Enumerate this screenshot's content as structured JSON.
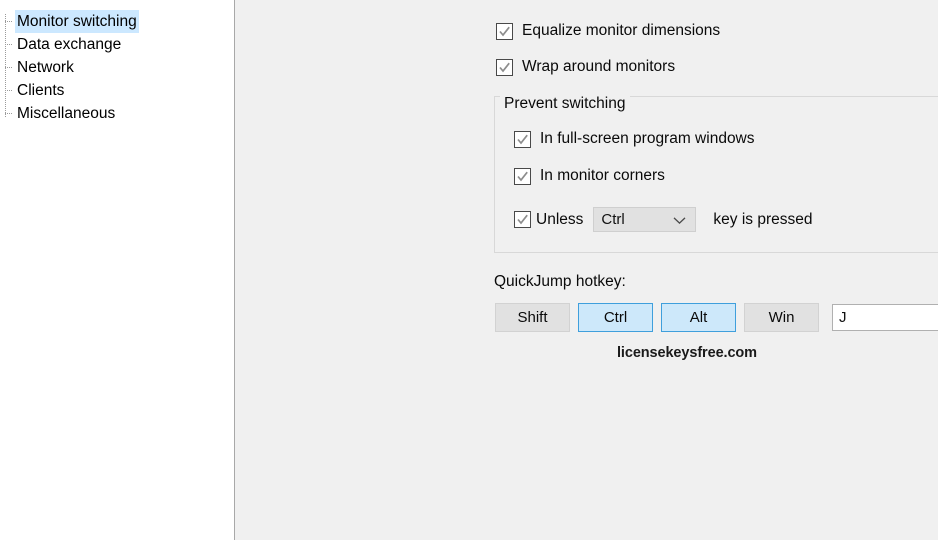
{
  "sidebar": {
    "items": [
      {
        "label": "Monitor switching",
        "selected": true
      },
      {
        "label": "Data exchange",
        "selected": false
      },
      {
        "label": "Network",
        "selected": false
      },
      {
        "label": "Clients",
        "selected": false
      },
      {
        "label": "Miscellaneous",
        "selected": false
      }
    ]
  },
  "main": {
    "checkboxes": [
      {
        "label": "Equalize monitor dimensions",
        "checked": true
      },
      {
        "label": "Wrap around monitors",
        "checked": true
      }
    ],
    "group": {
      "title": "Prevent switching",
      "checkboxes": [
        {
          "label": "In full-screen program windows",
          "checked": true
        },
        {
          "label": "In monitor corners",
          "checked": true
        }
      ],
      "unless_row": {
        "checked": true,
        "prefix_label": "Unless",
        "key_value": "Ctrl",
        "suffix_label": "key is pressed"
      }
    },
    "quickjump": {
      "section_label": "QuickJump hotkey:",
      "modifiers": [
        {
          "label": "Shift",
          "active": false
        },
        {
          "label": "Ctrl",
          "active": true
        },
        {
          "label": "Alt",
          "active": true
        },
        {
          "label": "Win",
          "active": false
        }
      ],
      "key_value": "J"
    },
    "watermark": "licensekeysfree.com"
  },
  "colors": {
    "selection_blue": "#cce8ff",
    "button_active_fill": "#cde8fa",
    "button_active_border": "#3f9fdc",
    "panel_gray": "#f0f0f0",
    "tree_bg": "#ffffff"
  },
  "icons": {
    "checkmark": "check-icon",
    "chevron": "chevron-down-icon"
  }
}
